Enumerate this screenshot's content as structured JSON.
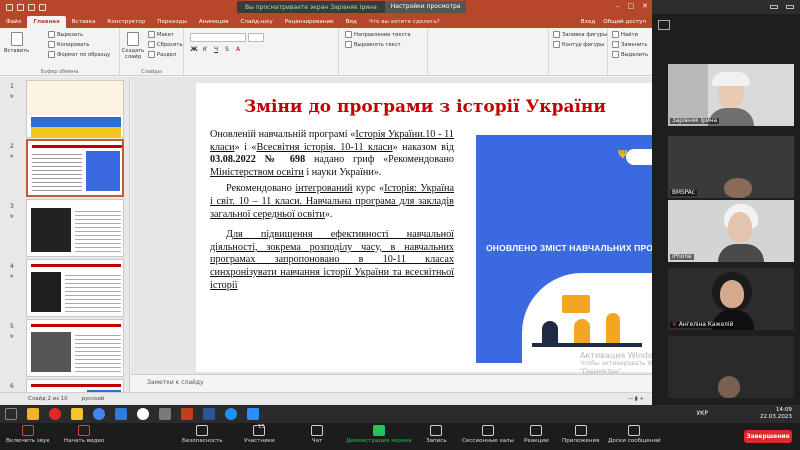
{
  "powerpoint": {
    "share_banner": {
      "status": "Вы просматриваете экран Зарівняк Ірина",
      "options_label": "Настройки просмотра"
    },
    "menu_tabs": [
      "Файл",
      "Главная",
      "Вставка",
      "Конструктор",
      "Переходы",
      "Анимация",
      "Слайд-шоу",
      "Рецензирование",
      "Вид"
    ],
    "active_tab": "Главная",
    "search_hint": "Что вы хотите сделать?",
    "signin": "Вход",
    "share": "Общий доступ",
    "ribbon": {
      "clipboard_group": "Буфер обмена",
      "paste": "Вставить",
      "cut": "Вырезать",
      "copy": "Копировать",
      "format_painter": "Формат по образцу",
      "new_slide": "Создать слайд",
      "layout": "Макет",
      "reset": "Сбросить",
      "section": "Раздел",
      "slides_group": "Слайды",
      "text_direction": "Направление текста",
      "align_text": "Выровнять текст",
      "fill_shape": "Заливка фигуры",
      "outline_shape": "Контур фигуры",
      "find": "Найти",
      "replace": "Заменить",
      "select": "Выделить"
    },
    "slide": {
      "title": "Зміни до програми з історії України",
      "p1_a": "Оновленій навчальній програмі «",
      "p1_u1": "Історія України.10 - 11 класи",
      "p1_b": "» і «",
      "p1_u2": "Всесвітня історія. 10-11 класи",
      "p1_c": "» наказом від ",
      "p1_date": "03.08.2022 № 698",
      "p1_d": " надано гриф «Рекомендовано ",
      "p1_u3": "Міністерством освіти",
      "p1_e": " і науки України».",
      "p2_a": "Рекомендовано ",
      "p2_u1": "інтегрований",
      "p2_b": " курс «",
      "p2_u2": "Історія: Україна і світ. 10 – 11 класи. Навчальна програма для закладів загальної середньої освіти",
      "p2_c": "».",
      "p3": "Для підвищення ефективності навчальної діяльності, зокрема розподілу часу, в навчальних програмах запропоновано в 10-11 класах синхронізувати навчання історії України та всесвітньої історії",
      "promo_text": "ОНОВЛЕНО ЗМІСТ НАВЧАЛЬНИХ ПРОГ"
    },
    "watermark": [
      "Активация Windows",
      "Чтобы активировать Windows, перейдите в раздел",
      "\"Параметры\"."
    ],
    "notes_placeholder": "Заметки к слайду",
    "status": {
      "slide_counter": "Слайд 2 из 10",
      "language": "русский"
    },
    "thumbnail_numbers": [
      "1",
      "2",
      "3",
      "4",
      "5",
      "6"
    ]
  },
  "taskbar": {
    "language": "УКР",
    "time": "14:09",
    "date": "22.03.2023"
  },
  "zoom": {
    "participants": [
      {
        "name": "Зарівняк Ірина",
        "muted": false
      },
      {
        "name": "BMSPAc",
        "muted": false
      },
      {
        "name": "iPhone",
        "muted": false
      },
      {
        "name": "Ангеліна Кажелій",
        "muted": true
      }
    ],
    "controls": {
      "audio": "Включить звук",
      "video": "Начать видео",
      "security": "Безопасность",
      "participants": "Участники",
      "participants_count": "15",
      "chat": "Чат",
      "share": "Демонстрация экрана",
      "record": "Запись",
      "breakout": "Сессионные залы",
      "reactions": "Реакции",
      "apps": "Приложения",
      "whiteboards": "Доски сообщений",
      "end": "Завершение"
    },
    "colors": {
      "share_active": "#24c35b",
      "end_button": "#e02828",
      "muted": "#e24b4b"
    }
  }
}
